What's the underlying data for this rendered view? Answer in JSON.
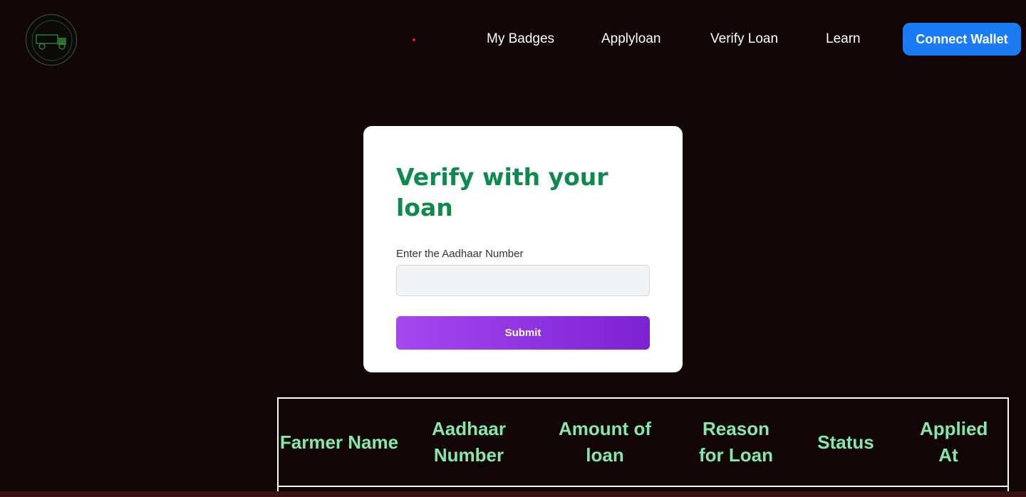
{
  "nav": {
    "items": [
      "My Badges",
      "Applyloan",
      "Verify Loan",
      "Learn"
    ],
    "connect_wallet": "Connect Wallet"
  },
  "card": {
    "title": "Verify with your loan",
    "label": "Enter the Aadhaar Number",
    "input_value": "",
    "submit": "Submit"
  },
  "table": {
    "headers": [
      "Farmer Name",
      "Aadhaar Number",
      "Amount of loan",
      "Reason for Loan",
      "Status",
      "Applied At"
    ]
  },
  "colors": {
    "background": "#120506",
    "accent": "#1a7cf5",
    "title": "#0e8a4f",
    "header": "#86e8a6"
  }
}
